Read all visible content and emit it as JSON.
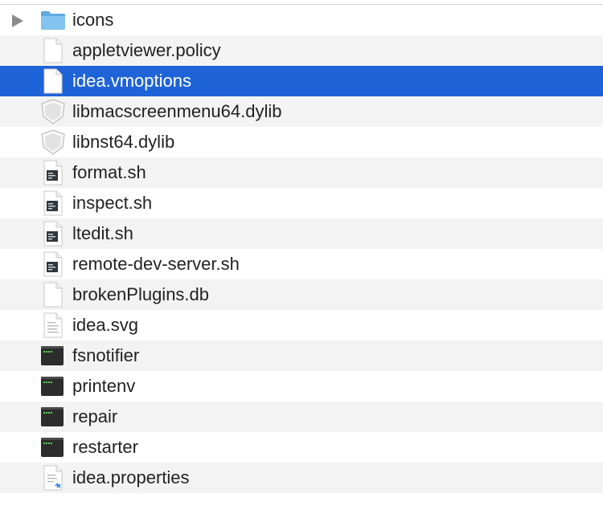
{
  "window": {
    "title": ""
  },
  "files": [
    {
      "name": "icons",
      "kind": "folder",
      "icon": "folder-icon",
      "has_disclosure": true
    },
    {
      "name": "appletviewer.policy",
      "kind": "document",
      "icon": "document-icon"
    },
    {
      "name": "idea.vmoptions",
      "kind": "document",
      "icon": "document-icon",
      "selected": true
    },
    {
      "name": "libmacscreenmenu64.dylib",
      "kind": "library",
      "icon": "dylib-icon"
    },
    {
      "name": "libnst64.dylib",
      "kind": "library",
      "icon": "dylib-icon"
    },
    {
      "name": "format.sh",
      "kind": "script",
      "icon": "shell-script-icon"
    },
    {
      "name": "inspect.sh",
      "kind": "script",
      "icon": "shell-script-icon"
    },
    {
      "name": "ltedit.sh",
      "kind": "script",
      "icon": "shell-script-icon"
    },
    {
      "name": "remote-dev-server.sh",
      "kind": "script",
      "icon": "shell-script-icon"
    },
    {
      "name": "brokenPlugins.db",
      "kind": "document",
      "icon": "document-icon"
    },
    {
      "name": "idea.svg",
      "kind": "text",
      "icon": "text-document-icon"
    },
    {
      "name": "fsnotifier",
      "kind": "executable",
      "icon": "terminal-executable-icon"
    },
    {
      "name": "printenv",
      "kind": "executable",
      "icon": "terminal-executable-icon"
    },
    {
      "name": "repair",
      "kind": "executable",
      "icon": "terminal-executable-icon"
    },
    {
      "name": "restarter",
      "kind": "executable",
      "icon": "terminal-executable-icon"
    },
    {
      "name": "idea.properties",
      "kind": "properties",
      "icon": "properties-document-icon"
    }
  ],
  "colors": {
    "selection": "#1f63d8",
    "alternate_row": "#f3f3f3",
    "text": "#222222",
    "selected_text": "#ffffff",
    "folder": "#6fb5e8",
    "terminal_green": "#5fd35a"
  }
}
